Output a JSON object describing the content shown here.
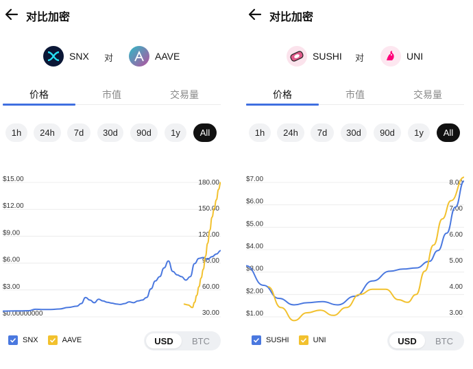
{
  "colors": {
    "accent": "#3f6fe0",
    "series_a": "#4a78df",
    "series_b": "#f2c12e",
    "chip_active_bg": "#111111"
  },
  "panels": [
    {
      "header": {
        "title": "对比加密",
        "back_icon": "arrow-left-icon"
      },
      "compare": {
        "coin_a": "SNX",
        "vs": "对",
        "coin_b": "AAVE"
      },
      "tabs": [
        "价格",
        "市值",
        "交易量"
      ],
      "periods": [
        "1h",
        "24h",
        "7d",
        "30d",
        "90d",
        "1y",
        "All"
      ],
      "selected_period": "All",
      "legend": {
        "a": "SNX",
        "b": "AAVE"
      },
      "currency": {
        "usd": "USD",
        "btc": "BTC",
        "selected": "USD"
      }
    },
    {
      "header": {
        "title": "对比加密",
        "back_icon": "arrow-left-icon"
      },
      "compare": {
        "coin_a": "SUSHI",
        "vs": "对",
        "coin_b": "UNI"
      },
      "tabs": [
        "价格",
        "市值",
        "交易量"
      ],
      "periods": [
        "1h",
        "24h",
        "7d",
        "30d",
        "90d",
        "1y",
        "All"
      ],
      "selected_period": "All",
      "legend": {
        "a": "SUSHI",
        "b": "UNI"
      },
      "currency": {
        "usd": "USD",
        "btc": "BTC",
        "selected": "USD"
      }
    }
  ],
  "chart_data": [
    {
      "type": "line",
      "left_axis": {
        "ticks": [
          "$15.00",
          "$12.00",
          "$9.00",
          "$6.00",
          "$3.00",
          "$0.00000000"
        ],
        "ylim": [
          0,
          15
        ]
      },
      "right_axis": {
        "ticks": [
          "180.00",
          "150.00",
          "120.00",
          "90.00",
          "60.00",
          "30.00"
        ],
        "ylim": [
          30,
          180
        ]
      },
      "series": [
        {
          "name": "SNX",
          "axis": "left",
          "x": [
            0,
            4,
            8,
            12,
            15,
            18,
            22,
            26,
            30,
            34,
            36,
            38,
            40,
            42,
            44,
            46,
            48,
            50,
            52,
            54,
            56,
            58,
            60,
            62,
            64,
            66,
            68,
            70,
            72,
            74,
            76,
            78,
            80,
            82,
            84,
            86,
            88,
            90,
            92,
            94,
            96,
            98,
            100
          ],
          "values": [
            0.03,
            0.05,
            0.06,
            0.08,
            0.25,
            0.22,
            0.22,
            0.28,
            0.45,
            0.6,
            0.9,
            1.6,
            1.3,
            1.0,
            1.4,
            1.2,
            1.05,
            0.95,
            0.85,
            0.8,
            0.9,
            1.1,
            1.0,
            1.2,
            1.3,
            1.6,
            2.6,
            3.5,
            4.0,
            5.0,
            5.8,
            4.6,
            4.2,
            4.0,
            3.6,
            4.0,
            5.5,
            6.1,
            6.2,
            6.0,
            6.3,
            6.6,
            7.0
          ]
        },
        {
          "name": "AAVE",
          "axis": "right",
          "x": [
            83,
            85,
            87,
            88,
            89,
            90,
            91,
            92,
            93,
            94,
            95,
            96,
            97,
            98,
            99,
            100
          ],
          "values": [
            40,
            39,
            36,
            42,
            50,
            60,
            70,
            80,
            95,
            110,
            125,
            140,
            150,
            160,
            172,
            180
          ]
        }
      ]
    },
    {
      "type": "line",
      "left_axis": {
        "ticks": [
          "$7.00",
          "$6.00",
          "$5.00",
          "$4.00",
          "$3.00",
          "$2.00",
          "$1.00"
        ],
        "ylim": [
          1,
          7
        ]
      },
      "right_axis": {
        "ticks": [
          "8.00",
          "7.00",
          "6.00",
          "5.00",
          "4.00",
          "3.00"
        ],
        "ylim": [
          3,
          8
        ]
      },
      "series": [
        {
          "name": "SUSHI",
          "axis": "left",
          "x": [
            0,
            8,
            15,
            22,
            28,
            35,
            42,
            50,
            58,
            66,
            72,
            78,
            84,
            88,
            92,
            96,
            100
          ],
          "values": [
            3.1,
            2.2,
            1.6,
            1.3,
            1.4,
            1.45,
            1.3,
            1.7,
            2.4,
            2.85,
            2.95,
            3.0,
            3.3,
            3.8,
            4.6,
            5.8,
            7.0
          ]
        },
        {
          "name": "UNI",
          "axis": "right",
          "x": [
            10,
            16,
            22,
            28,
            34,
            40,
            46,
            52,
            58,
            64,
            70,
            74,
            78,
            82,
            86,
            90,
            94,
            100
          ],
          "values": [
            4.0,
            3.2,
            2.7,
            3.0,
            3.1,
            2.9,
            3.2,
            3.7,
            3.9,
            3.9,
            3.5,
            3.4,
            3.7,
            4.6,
            5.6,
            6.6,
            7.3,
            8.2
          ]
        }
      ]
    }
  ]
}
